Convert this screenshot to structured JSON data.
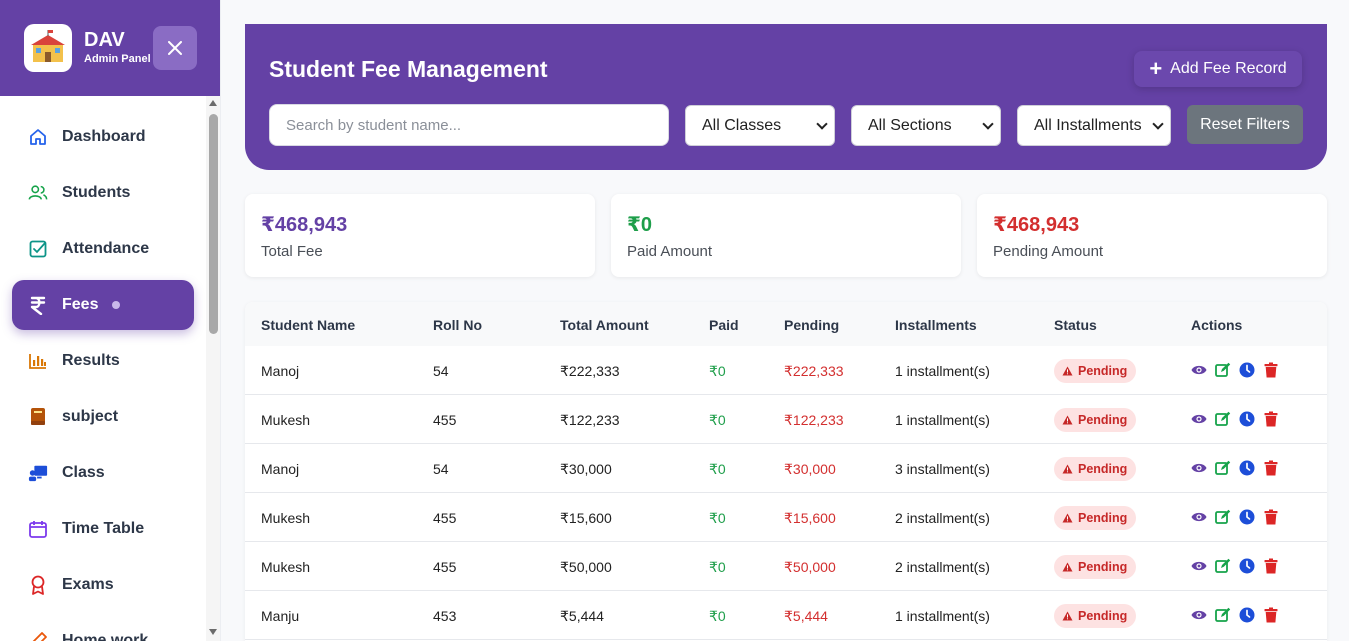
{
  "brand": {
    "title": "DAV",
    "subtitle": "Admin Panel"
  },
  "sidebar": {
    "items": [
      {
        "label": "Dashboard",
        "icon": "home-icon",
        "color": "#2563eb"
      },
      {
        "label": "Students",
        "icon": "users-icon",
        "color": "#16a34a"
      },
      {
        "label": "Attendance",
        "icon": "check-square-icon",
        "color": "#0d9488"
      },
      {
        "label": "Fees",
        "icon": "rupee-icon",
        "color": "#ffffff",
        "active": true
      },
      {
        "label": "Results",
        "icon": "bar-chart-icon",
        "color": "#d97706"
      },
      {
        "label": "subject",
        "icon": "book-icon",
        "color": "#b45309"
      },
      {
        "label": "Class",
        "icon": "teacher-board-icon",
        "color": "#1d4ed8"
      },
      {
        "label": "Time Table",
        "icon": "calendar-icon",
        "color": "#7c3aed"
      },
      {
        "label": "Exams",
        "icon": "award-icon",
        "color": "#dc2626"
      },
      {
        "label": "Home work",
        "icon": "pencil-icon",
        "color": "#ea580c"
      }
    ]
  },
  "header": {
    "title": "Student Fee Management",
    "add_label": "Add Fee Record",
    "search_placeholder": "Search by student name...",
    "class_filter": "All Classes",
    "section_filter": "All Sections",
    "installment_filter": "All Installments",
    "reset_label": "Reset Filters"
  },
  "summary": {
    "total": {
      "amount": "₹468,943",
      "caption": "Total Fee",
      "color": "#6441a5"
    },
    "paid": {
      "amount": "₹0",
      "caption": "Paid Amount",
      "color": "#1e9e4a"
    },
    "pending": {
      "amount": "₹468,943",
      "caption": "Pending Amount",
      "color": "#d32f2f"
    }
  },
  "table": {
    "columns": [
      "Student Name",
      "Roll No",
      "Total Amount",
      "Paid",
      "Pending",
      "Installments",
      "Status",
      "Actions"
    ],
    "rows": [
      {
        "name": "Manoj",
        "roll": "54",
        "total": "₹222,333",
        "paid": "₹0",
        "pending": "₹222,333",
        "installments": "1 installment(s)",
        "status": "Pending"
      },
      {
        "name": "Mukesh",
        "roll": "455",
        "total": "₹122,233",
        "paid": "₹0",
        "pending": "₹122,233",
        "installments": "1 installment(s)",
        "status": "Pending"
      },
      {
        "name": "Manoj",
        "roll": "54",
        "total": "₹30,000",
        "paid": "₹0",
        "pending": "₹30,000",
        "installments": "3 installment(s)",
        "status": "Pending"
      },
      {
        "name": "Mukesh",
        "roll": "455",
        "total": "₹15,600",
        "paid": "₹0",
        "pending": "₹15,600",
        "installments": "2 installment(s)",
        "status": "Pending"
      },
      {
        "name": "Mukesh",
        "roll": "455",
        "total": "₹50,000",
        "paid": "₹0",
        "pending": "₹50,000",
        "installments": "2 installment(s)",
        "status": "Pending"
      },
      {
        "name": "Manju",
        "roll": "453",
        "total": "₹5,444",
        "paid": "₹0",
        "pending": "₹5,444",
        "installments": "1 installment(s)",
        "status": "Pending"
      }
    ]
  }
}
